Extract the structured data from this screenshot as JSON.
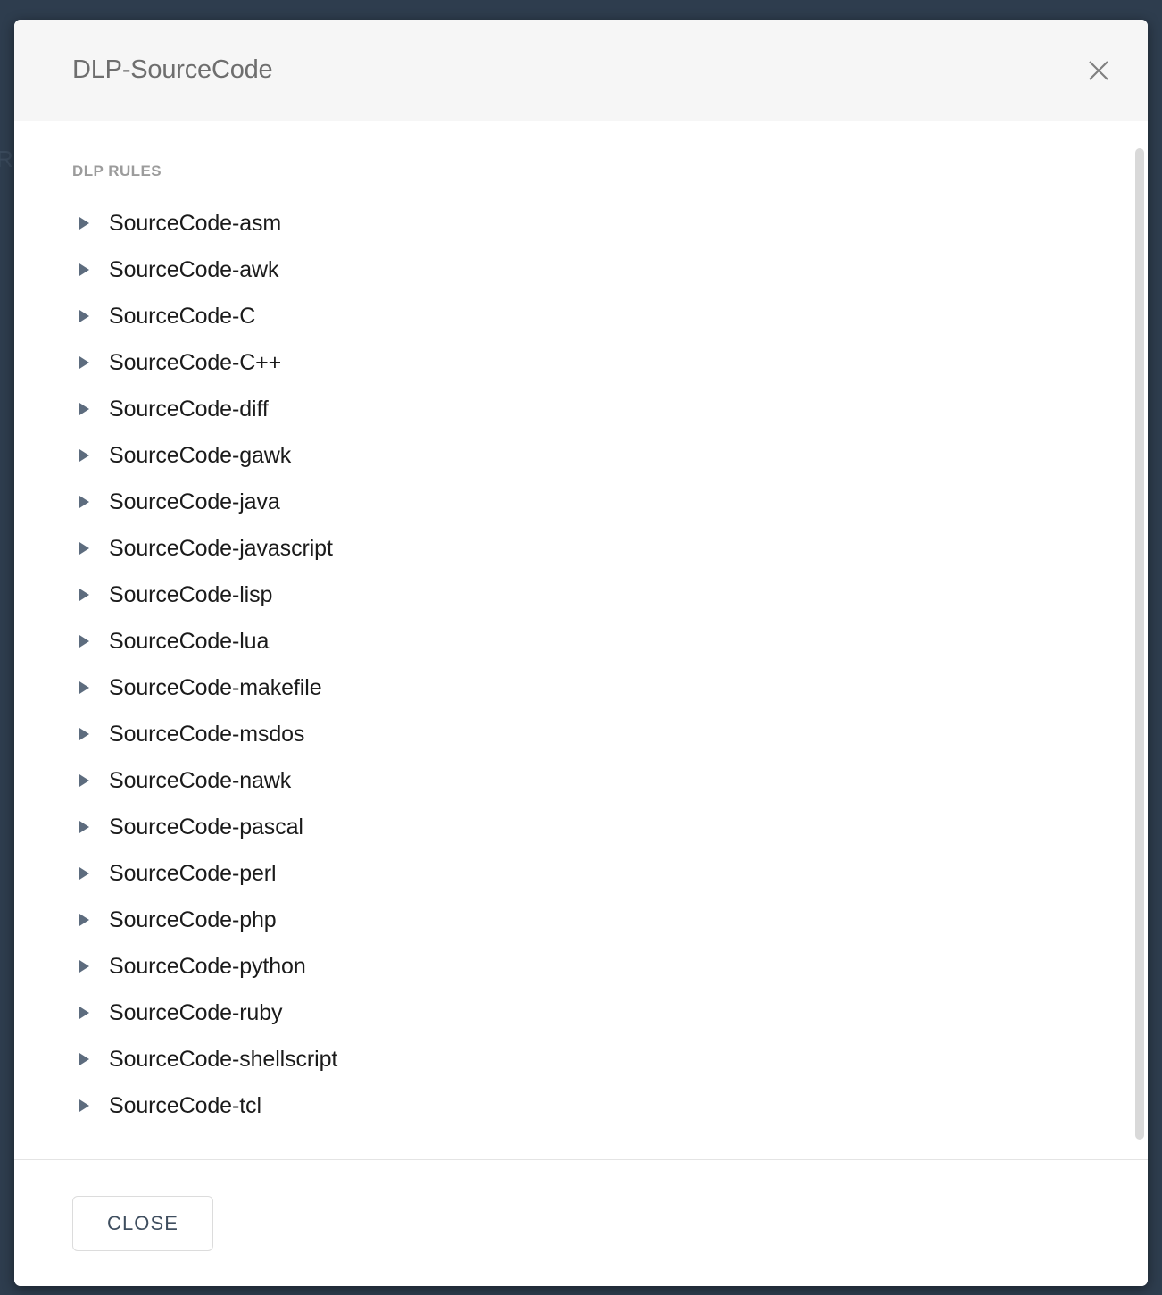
{
  "backdrop": {
    "partial_text": "R",
    "color": "#2e3d4e"
  },
  "modal": {
    "title": "DLP-SourceCode",
    "close_icon": "close-icon",
    "body": {
      "section_label": "DLP RULES",
      "caret_icon": "triangle-right-icon",
      "rules": [
        {
          "label": "SourceCode-asm"
        },
        {
          "label": "SourceCode-awk"
        },
        {
          "label": "SourceCode-C"
        },
        {
          "label": "SourceCode-C++"
        },
        {
          "label": "SourceCode-diff"
        },
        {
          "label": "SourceCode-gawk"
        },
        {
          "label": "SourceCode-java"
        },
        {
          "label": "SourceCode-javascript"
        },
        {
          "label": "SourceCode-lisp"
        },
        {
          "label": "SourceCode-lua"
        },
        {
          "label": "SourceCode-makefile"
        },
        {
          "label": "SourceCode-msdos"
        },
        {
          "label": "SourceCode-nawk"
        },
        {
          "label": "SourceCode-pascal"
        },
        {
          "label": "SourceCode-perl"
        },
        {
          "label": "SourceCode-php"
        },
        {
          "label": "SourceCode-python"
        },
        {
          "label": "SourceCode-ruby"
        },
        {
          "label": "SourceCode-shellscript"
        },
        {
          "label": "SourceCode-tcl"
        }
      ]
    },
    "footer": {
      "close_label": "CLOSE"
    }
  },
  "colors": {
    "backdrop": "#2e3d4e",
    "modal_background": "#ffffff",
    "header_background": "#f6f6f6",
    "title_text": "#6e6e6e",
    "section_label_text": "#9c9c9c",
    "rule_text": "#1b1b1b",
    "caret_fill": "#5d6c7e",
    "button_text": "#3f4e5f",
    "button_border": "#dcdcdc",
    "scrollbar_thumb": "#d9d9d9",
    "divider": "#e2e2e2"
  }
}
